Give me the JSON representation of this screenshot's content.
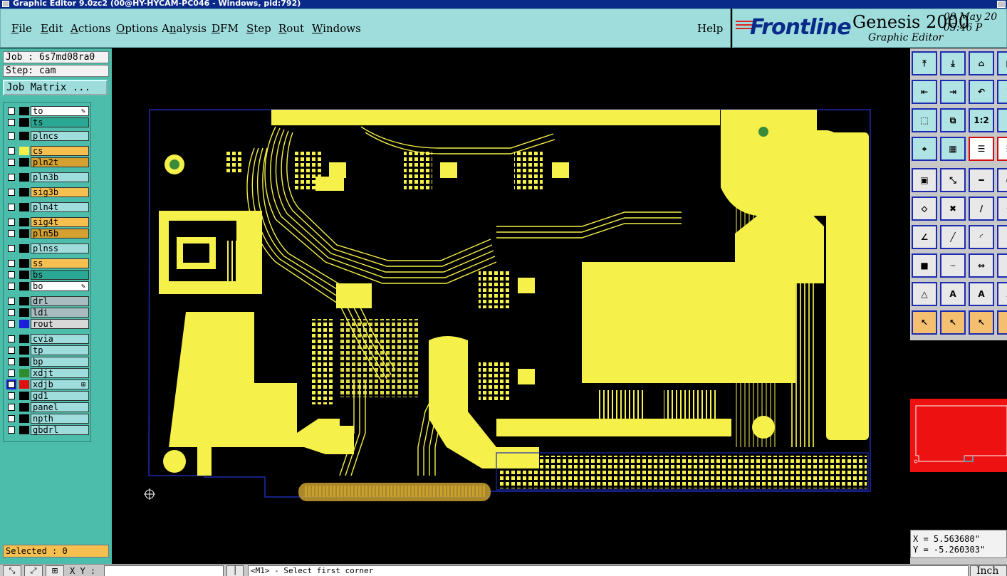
{
  "window": {
    "title": "Graphic Editor 9.0zc2 (00@HY-HYCAM-PC046 - Windows, pid:792)"
  },
  "menubar": {
    "items": [
      {
        "label": "File",
        "hotkey": "F"
      },
      {
        "label": "Edit",
        "hotkey": "E"
      },
      {
        "label": "Actions",
        "hotkey": "A"
      },
      {
        "label": "Options",
        "hotkey": "O"
      },
      {
        "label": "Analysis",
        "hotkey": "n"
      },
      {
        "label": "DFM",
        "hotkey": "D"
      },
      {
        "label": "Step",
        "hotkey": "S"
      },
      {
        "label": "Rout",
        "hotkey": "R"
      },
      {
        "label": "Windows",
        "hotkey": "W"
      }
    ],
    "help": "Help"
  },
  "brand": {
    "logo": "Frontline",
    "product": "Genesis 2000",
    "subtitle": "Graphic Editor",
    "date": "09 May 20",
    "time": "05:46 P"
  },
  "job": {
    "job_line": "Job : 6s7md08ra0",
    "step_line": "Step: cam",
    "matrix_button": "Job Matrix ..."
  },
  "layers": [
    {
      "name": "to",
      "color": "#ffffff",
      "swatch": "#000000",
      "marker": "✎"
    },
    {
      "name": "ts",
      "color": "#2aa893",
      "swatch": "#000000",
      "marker": ""
    },
    {
      "name": "plncs",
      "color": "#9fdddd",
      "swatch": "#000000",
      "marker": ""
    },
    {
      "name": "cs",
      "color": "#f6c050",
      "swatch": "#f6f04a",
      "marker": ""
    },
    {
      "name": "pln2t",
      "color": "#d4a030",
      "swatch": "#000000",
      "marker": ""
    },
    {
      "name": "pln3b",
      "color": "#9fdddd",
      "swatch": "#000000",
      "marker": ""
    },
    {
      "name": "sig3b",
      "color": "#f6c050",
      "swatch": "#000000",
      "marker": ""
    },
    {
      "name": "pln4t",
      "color": "#9fdddd",
      "swatch": "#000000",
      "marker": ""
    },
    {
      "name": "sig4t",
      "color": "#f6c050",
      "swatch": "#000000",
      "marker": ""
    },
    {
      "name": "pln5b",
      "color": "#d4a030",
      "swatch": "#000000",
      "marker": ""
    },
    {
      "name": "plnss",
      "color": "#9fdddd",
      "swatch": "#000000",
      "marker": ""
    },
    {
      "name": "ss",
      "color": "#f6c050",
      "swatch": "#000000",
      "marker": ""
    },
    {
      "name": "bs",
      "color": "#2aa893",
      "swatch": "#000000",
      "marker": ""
    },
    {
      "name": "bo",
      "color": "#ffffff",
      "swatch": "#000000",
      "marker": "✎"
    },
    {
      "name": "drl",
      "color": "#a8bcc0",
      "swatch": "#000000",
      "marker": ""
    },
    {
      "name": "ldi",
      "color": "#a8bcc0",
      "swatch": "#000000",
      "marker": ""
    },
    {
      "name": "rout",
      "color": "#d8d8d8",
      "swatch": "#1d1ddd",
      "marker": ""
    },
    {
      "name": "cvia",
      "color": "#9fdddd",
      "swatch": "#000000",
      "marker": ""
    },
    {
      "name": "tp",
      "color": "#9fdddd",
      "swatch": "#000000",
      "marker": ""
    },
    {
      "name": "bp",
      "color": "#9fdddd",
      "swatch": "#000000",
      "marker": ""
    },
    {
      "name": "xdjt",
      "color": "#9fdddd",
      "swatch": "#2e8c2e",
      "marker": ""
    },
    {
      "name": "xdjb",
      "color": "#9fdddd",
      "swatch": "#e01010",
      "marker": "⊞",
      "highlight": true
    },
    {
      "name": "gd1",
      "color": "#9fdddd",
      "swatch": "#000000",
      "marker": ""
    },
    {
      "name": "panel",
      "color": "#9fdddd",
      "swatch": "#000000",
      "marker": ""
    },
    {
      "name": "npth",
      "color": "#9fdddd",
      "swatch": "#000000",
      "marker": ""
    },
    {
      "name": "gbdrl",
      "color": "#9fdddd",
      "swatch": "#000000",
      "marker": ""
    }
  ],
  "selected": {
    "label": "Selected : 0"
  },
  "tools": [
    {
      "name": "move-up-icon",
      "style": "teal"
    },
    {
      "name": "move-down-icon",
      "style": "teal"
    },
    {
      "name": "home-icon",
      "style": "teal"
    },
    {
      "name": "panel-icon",
      "style": "teal"
    },
    {
      "name": "zoom-left-icon",
      "style": "teal"
    },
    {
      "name": "zoom-right-icon",
      "style": "teal"
    },
    {
      "name": "zoom-back-icon",
      "style": "teal"
    },
    {
      "name": "redraw-icon",
      "style": "teal"
    },
    {
      "name": "fit-window-icon",
      "style": "teal"
    },
    {
      "name": "fit-profile-icon",
      "style": "teal"
    },
    {
      "name": "one-to-two-icon",
      "style": "teal",
      "text": "1:2"
    },
    {
      "name": "measure-icon",
      "style": "teal"
    },
    {
      "name": "snap-icon",
      "style": "teal"
    },
    {
      "name": "grid-icon",
      "style": "teal"
    },
    {
      "name": "layers-icon",
      "style": "on"
    },
    {
      "name": "layers-alt-icon",
      "style": "on"
    },
    {
      "name": "select-pad-icon",
      "style": "plain"
    },
    {
      "name": "select-line-icon",
      "style": "plain"
    },
    {
      "name": "ruler-icon",
      "style": "plain"
    },
    {
      "name": "frame-icon",
      "style": "plain"
    },
    {
      "name": "line-nodes-icon",
      "style": "plain"
    },
    {
      "name": "cross-icon",
      "style": "plain"
    },
    {
      "name": "diag-line-icon",
      "style": "plain"
    },
    {
      "name": "line-end-icon",
      "style": "plain"
    },
    {
      "name": "angle-icon",
      "style": "plain"
    },
    {
      "name": "slash-icon",
      "style": "plain"
    },
    {
      "name": "arc-icon",
      "style": "plain"
    },
    {
      "name": "arc-alt-icon",
      "style": "plain"
    },
    {
      "name": "pad-add-icon",
      "style": "plain"
    },
    {
      "name": "dash-line-icon",
      "style": "plain"
    },
    {
      "name": "dimension-icon",
      "style": "plain"
    },
    {
      "name": "dimension-alt-icon",
      "style": "plain"
    },
    {
      "name": "triangle-icon",
      "style": "plain"
    },
    {
      "name": "text-a-icon",
      "style": "plain"
    },
    {
      "name": "text-a-bold-icon",
      "style": "plain"
    },
    {
      "name": "text-a-alt-icon",
      "style": "plain"
    },
    {
      "name": "pointer-icon",
      "style": "or"
    },
    {
      "name": "pointer-box-icon",
      "style": "or"
    },
    {
      "name": "pointer-circle-icon",
      "style": "or"
    },
    {
      "name": "pointer-alt-icon",
      "style": "or"
    }
  ],
  "coords": {
    "x": "X = 5.563680\"",
    "y": "Y = -5.260303\""
  },
  "statusbar": {
    "xy_label": "X Y :",
    "xy_value": "",
    "prompt": "<M1> - Select first corner",
    "units": "Inch"
  }
}
